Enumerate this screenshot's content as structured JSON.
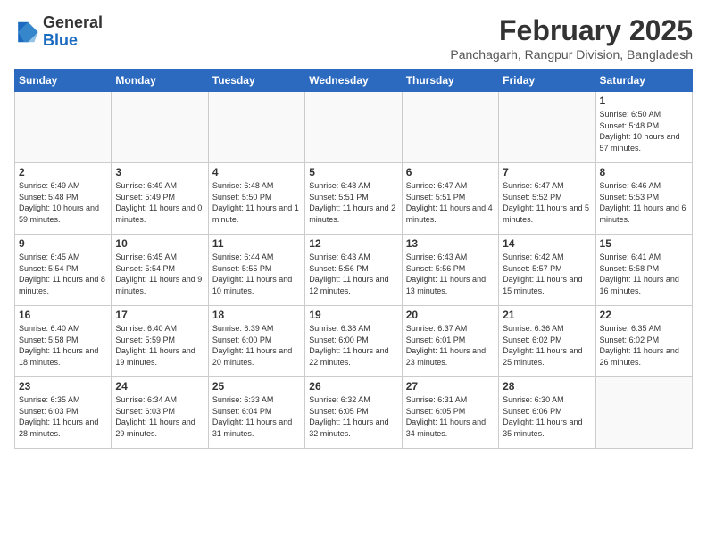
{
  "header": {
    "logo_general": "General",
    "logo_blue": "Blue",
    "month_title": "February 2025",
    "location": "Panchagarh, Rangpur Division, Bangladesh"
  },
  "days_of_week": [
    "Sunday",
    "Monday",
    "Tuesday",
    "Wednesday",
    "Thursday",
    "Friday",
    "Saturday"
  ],
  "weeks": [
    [
      {
        "day": "",
        "info": ""
      },
      {
        "day": "",
        "info": ""
      },
      {
        "day": "",
        "info": ""
      },
      {
        "day": "",
        "info": ""
      },
      {
        "day": "",
        "info": ""
      },
      {
        "day": "",
        "info": ""
      },
      {
        "day": "1",
        "info": "Sunrise: 6:50 AM\nSunset: 5:48 PM\nDaylight: 10 hours and 57 minutes."
      }
    ],
    [
      {
        "day": "2",
        "info": "Sunrise: 6:49 AM\nSunset: 5:48 PM\nDaylight: 10 hours and 59 minutes."
      },
      {
        "day": "3",
        "info": "Sunrise: 6:49 AM\nSunset: 5:49 PM\nDaylight: 11 hours and 0 minutes."
      },
      {
        "day": "4",
        "info": "Sunrise: 6:48 AM\nSunset: 5:50 PM\nDaylight: 11 hours and 1 minute."
      },
      {
        "day": "5",
        "info": "Sunrise: 6:48 AM\nSunset: 5:51 PM\nDaylight: 11 hours and 2 minutes."
      },
      {
        "day": "6",
        "info": "Sunrise: 6:47 AM\nSunset: 5:51 PM\nDaylight: 11 hours and 4 minutes."
      },
      {
        "day": "7",
        "info": "Sunrise: 6:47 AM\nSunset: 5:52 PM\nDaylight: 11 hours and 5 minutes."
      },
      {
        "day": "8",
        "info": "Sunrise: 6:46 AM\nSunset: 5:53 PM\nDaylight: 11 hours and 6 minutes."
      }
    ],
    [
      {
        "day": "9",
        "info": "Sunrise: 6:45 AM\nSunset: 5:54 PM\nDaylight: 11 hours and 8 minutes."
      },
      {
        "day": "10",
        "info": "Sunrise: 6:45 AM\nSunset: 5:54 PM\nDaylight: 11 hours and 9 minutes."
      },
      {
        "day": "11",
        "info": "Sunrise: 6:44 AM\nSunset: 5:55 PM\nDaylight: 11 hours and 10 minutes."
      },
      {
        "day": "12",
        "info": "Sunrise: 6:43 AM\nSunset: 5:56 PM\nDaylight: 11 hours and 12 minutes."
      },
      {
        "day": "13",
        "info": "Sunrise: 6:43 AM\nSunset: 5:56 PM\nDaylight: 11 hours and 13 minutes."
      },
      {
        "day": "14",
        "info": "Sunrise: 6:42 AM\nSunset: 5:57 PM\nDaylight: 11 hours and 15 minutes."
      },
      {
        "day": "15",
        "info": "Sunrise: 6:41 AM\nSunset: 5:58 PM\nDaylight: 11 hours and 16 minutes."
      }
    ],
    [
      {
        "day": "16",
        "info": "Sunrise: 6:40 AM\nSunset: 5:58 PM\nDaylight: 11 hours and 18 minutes."
      },
      {
        "day": "17",
        "info": "Sunrise: 6:40 AM\nSunset: 5:59 PM\nDaylight: 11 hours and 19 minutes."
      },
      {
        "day": "18",
        "info": "Sunrise: 6:39 AM\nSunset: 6:00 PM\nDaylight: 11 hours and 20 minutes."
      },
      {
        "day": "19",
        "info": "Sunrise: 6:38 AM\nSunset: 6:00 PM\nDaylight: 11 hours and 22 minutes."
      },
      {
        "day": "20",
        "info": "Sunrise: 6:37 AM\nSunset: 6:01 PM\nDaylight: 11 hours and 23 minutes."
      },
      {
        "day": "21",
        "info": "Sunrise: 6:36 AM\nSunset: 6:02 PM\nDaylight: 11 hours and 25 minutes."
      },
      {
        "day": "22",
        "info": "Sunrise: 6:35 AM\nSunset: 6:02 PM\nDaylight: 11 hours and 26 minutes."
      }
    ],
    [
      {
        "day": "23",
        "info": "Sunrise: 6:35 AM\nSunset: 6:03 PM\nDaylight: 11 hours and 28 minutes."
      },
      {
        "day": "24",
        "info": "Sunrise: 6:34 AM\nSunset: 6:03 PM\nDaylight: 11 hours and 29 minutes."
      },
      {
        "day": "25",
        "info": "Sunrise: 6:33 AM\nSunset: 6:04 PM\nDaylight: 11 hours and 31 minutes."
      },
      {
        "day": "26",
        "info": "Sunrise: 6:32 AM\nSunset: 6:05 PM\nDaylight: 11 hours and 32 minutes."
      },
      {
        "day": "27",
        "info": "Sunrise: 6:31 AM\nSunset: 6:05 PM\nDaylight: 11 hours and 34 minutes."
      },
      {
        "day": "28",
        "info": "Sunrise: 6:30 AM\nSunset: 6:06 PM\nDaylight: 11 hours and 35 minutes."
      },
      {
        "day": "",
        "info": ""
      }
    ]
  ]
}
